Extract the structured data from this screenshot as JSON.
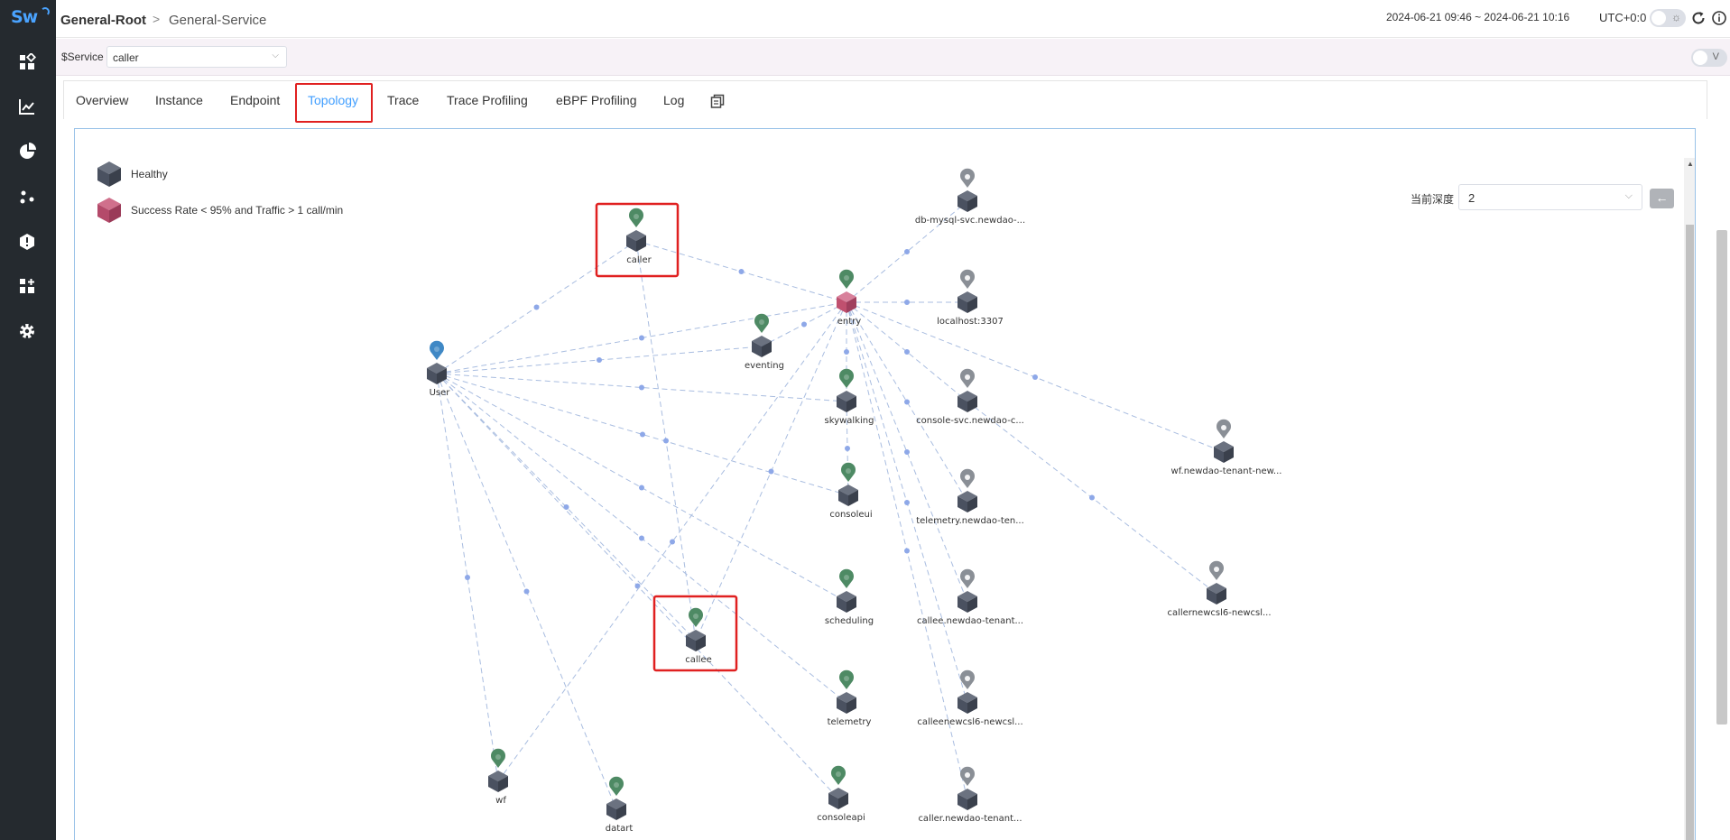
{
  "app": {
    "logo_text": "Sw"
  },
  "sidebar": {
    "icons": [
      {
        "name": "dashboard-icon"
      },
      {
        "name": "chart-icon"
      },
      {
        "name": "pie-icon"
      },
      {
        "name": "topology-icon"
      },
      {
        "name": "alarm-icon"
      },
      {
        "name": "plugins-icon"
      },
      {
        "name": "settings-icon"
      }
    ]
  },
  "header": {
    "breadcrumb_root": "General-Root",
    "breadcrumb_separator": ">",
    "breadcrumb_service": "General-Service",
    "time_range": "2024-06-21 09:46 ~ 2024-06-21 10:16",
    "timezone": "UTC+0:0"
  },
  "service_bar": {
    "label": "$Service",
    "selected": "caller",
    "v_toggle_label": "V"
  },
  "tabs": [
    {
      "label": "Overview",
      "active": false
    },
    {
      "label": "Instance",
      "active": false
    },
    {
      "label": "Endpoint",
      "active": false
    },
    {
      "label": "Topology",
      "active": true
    },
    {
      "label": "Trace",
      "active": false
    },
    {
      "label": "Trace Profiling",
      "active": false
    },
    {
      "label": "eBPF Profiling",
      "active": false
    },
    {
      "label": "Log",
      "active": false
    }
  ],
  "topology": {
    "legend": [
      {
        "label": "Healthy",
        "color": "#4a5160"
      },
      {
        "label": "Success Rate < 95% and Traffic > 1 call/min",
        "color": "#b44a6a"
      }
    ],
    "depth_label": "当前深度",
    "depth_value": "2",
    "back_button": "←",
    "colors": {
      "healthy": "#4a5160",
      "unhealthy": "#c0506f",
      "edge": "#a9bde0",
      "pin_green": "#4e8a64",
      "pin_blue": "#3f88c5",
      "pin_gray": "#8a8f96",
      "highlight": "#e02020"
    },
    "nodes": [
      {
        "id": "caller",
        "label": "caller",
        "pin": "green",
        "health": "healthy"
      },
      {
        "id": "entry",
        "label": "entry",
        "pin": "green",
        "health": "unhealthy"
      },
      {
        "id": "db",
        "label": "db-mysql-svc.newdao-...",
        "pin": "gray",
        "health": "healthy"
      },
      {
        "id": "localhost",
        "label": "localhost:3307",
        "pin": "gray",
        "health": "healthy"
      },
      {
        "id": "user",
        "label": "User",
        "pin": "blue",
        "health": "healthy"
      },
      {
        "id": "eventing",
        "label": "eventing",
        "pin": "green",
        "health": "healthy"
      },
      {
        "id": "skywalking",
        "label": "skywalking",
        "pin": "green",
        "health": "healthy"
      },
      {
        "id": "console_svc",
        "label": "console-svc.newdao-c...",
        "pin": "gray",
        "health": "healthy"
      },
      {
        "id": "wf_newdao",
        "label": "wf.newdao-tenant-new...",
        "pin": "gray",
        "health": "healthy"
      },
      {
        "id": "consoleui",
        "label": "consoleui",
        "pin": "green",
        "health": "healthy"
      },
      {
        "id": "telemetry_newdao",
        "label": "telemetry.newdao-ten...",
        "pin": "gray",
        "health": "healthy"
      },
      {
        "id": "scheduling",
        "label": "scheduling",
        "pin": "green",
        "health": "healthy"
      },
      {
        "id": "callee_newdao",
        "label": "callee.newdao-tenant...",
        "pin": "gray",
        "health": "healthy"
      },
      {
        "id": "callernewcsl6",
        "label": "callernewcsl6-newcsl...",
        "pin": "gray",
        "health": "healthy"
      },
      {
        "id": "callee",
        "label": "callee",
        "pin": "green",
        "health": "healthy"
      },
      {
        "id": "telemetry",
        "label": "telemetry",
        "pin": "green",
        "health": "healthy"
      },
      {
        "id": "calleenewcsl6",
        "label": "calleenewcsl6-newcsl...",
        "pin": "gray",
        "health": "healthy"
      },
      {
        "id": "wf",
        "label": "wf",
        "pin": "green",
        "health": "healthy"
      },
      {
        "id": "datart",
        "label": "datart",
        "pin": "green",
        "health": "healthy"
      },
      {
        "id": "consoleapi",
        "label": "consoleapi",
        "pin": "green",
        "health": "healthy"
      },
      {
        "id": "caller_newdao",
        "label": "caller.newdao-tenant...",
        "pin": "gray",
        "health": "healthy"
      }
    ],
    "edges": [
      [
        "user",
        "caller"
      ],
      [
        "user",
        "entry"
      ],
      [
        "user",
        "eventing"
      ],
      [
        "user",
        "skywalking"
      ],
      [
        "user",
        "consoleui"
      ],
      [
        "user",
        "scheduling"
      ],
      [
        "user",
        "callee"
      ],
      [
        "user",
        "telemetry"
      ],
      [
        "user",
        "consoleapi"
      ],
      [
        "user",
        "wf"
      ],
      [
        "user",
        "datart"
      ],
      [
        "caller",
        "entry"
      ],
      [
        "caller",
        "callee"
      ],
      [
        "entry",
        "db"
      ],
      [
        "entry",
        "localhost"
      ],
      [
        "entry",
        "skywalking"
      ],
      [
        "entry",
        "console_svc"
      ],
      [
        "entry",
        "wf_newdao"
      ],
      [
        "entry",
        "telemetry_newdao"
      ],
      [
        "entry",
        "callee_newdao"
      ],
      [
        "entry",
        "calleenewcsl6"
      ],
      [
        "entry",
        "caller_newdao"
      ],
      [
        "entry",
        "callee"
      ],
      [
        "entry",
        "wf"
      ],
      [
        "entry",
        "eventing"
      ],
      [
        "skywalking",
        "consoleui"
      ],
      [
        "console_svc",
        "callernewcsl6"
      ]
    ]
  }
}
